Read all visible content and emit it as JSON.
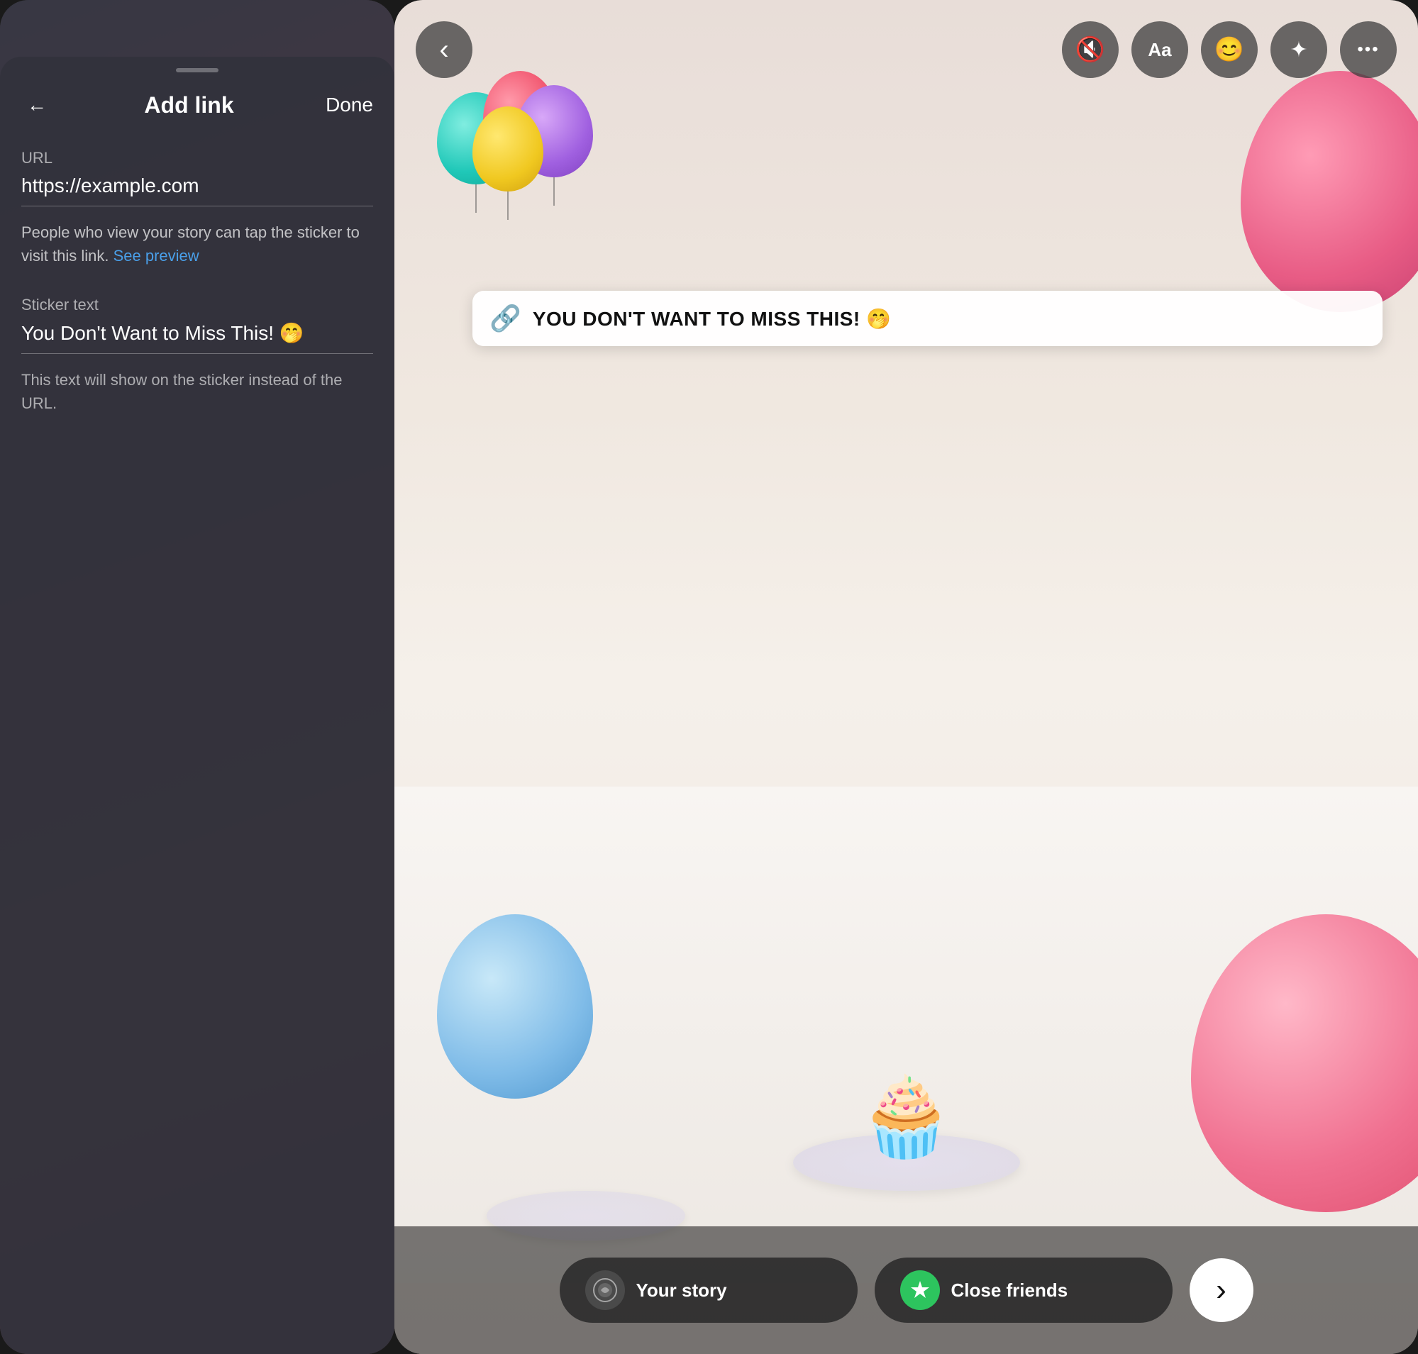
{
  "left_panel": {
    "title": "Add link",
    "back_label": "←",
    "done_label": "Done",
    "url_label": "URL",
    "url_value": "https://example.com",
    "description": "People who view your story can tap the sticker to visit this link. ",
    "description_link": "See preview",
    "sticker_label": "Sticker text",
    "sticker_value": "You Don't Want to Miss This! 🤭",
    "sticker_hint": "This text will show on the sticker instead of the URL."
  },
  "right_panel": {
    "toolbar": {
      "back_icon": "‹",
      "sound_icon": "🔇",
      "text_icon": "Aa",
      "sticker_icon": "😊",
      "effects_icon": "✦",
      "more_icon": "•••"
    },
    "sticker": {
      "link_icon": "🔗",
      "text": "YOU DON'T WANT TO MISS THIS! 🤭"
    },
    "bottom_bar": {
      "your_story_label": "Your story",
      "close_friends_label": "Close friends",
      "next_icon": "›"
    }
  }
}
